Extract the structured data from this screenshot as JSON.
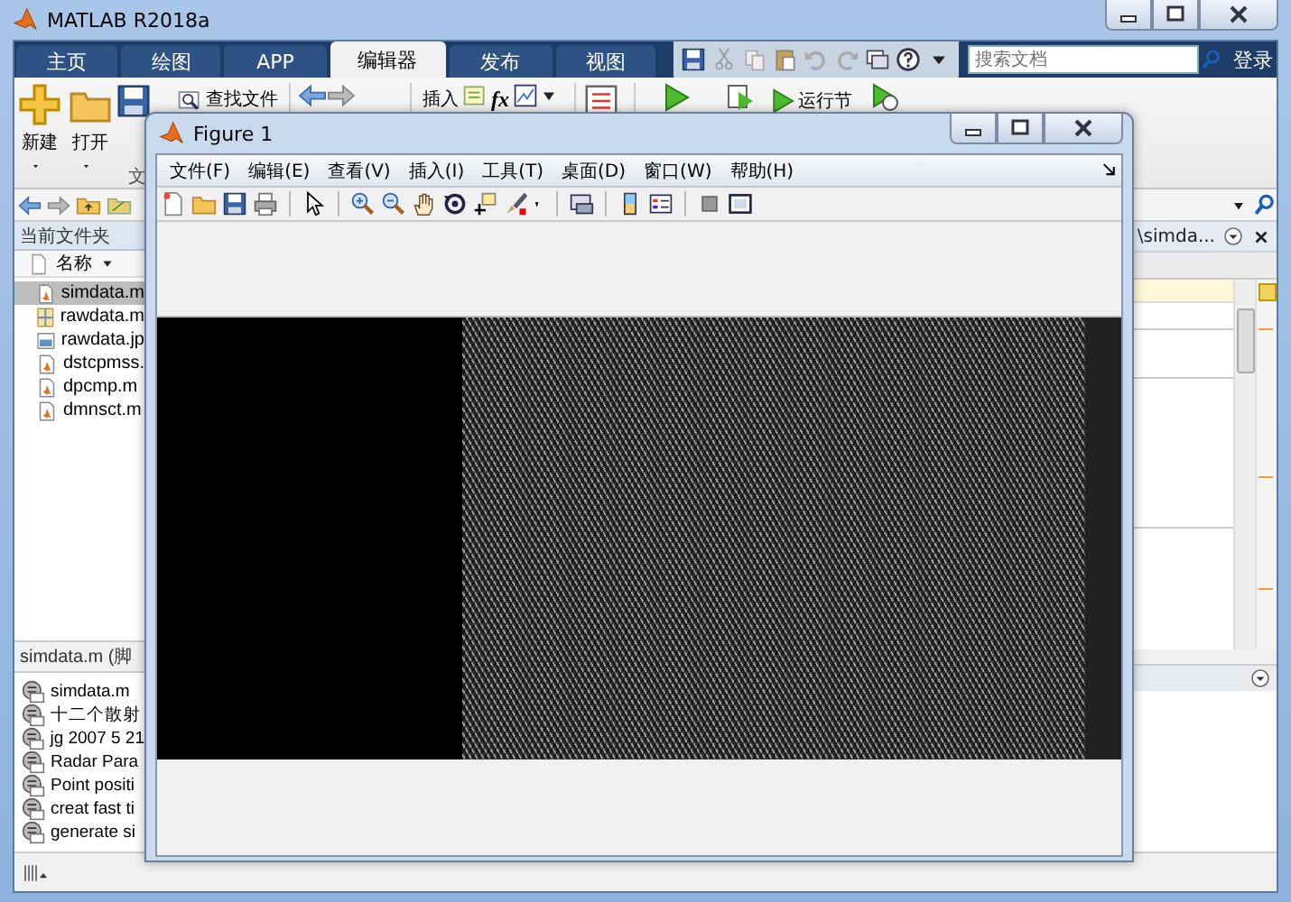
{
  "window": {
    "title": "MATLAB R2018a"
  },
  "tabs": [
    {
      "label": "主页",
      "selected": false
    },
    {
      "label": "绘图",
      "selected": false
    },
    {
      "label": "APP",
      "selected": false
    },
    {
      "label": "编辑器",
      "selected": true
    },
    {
      "label": "发布",
      "selected": false
    },
    {
      "label": "视图",
      "selected": false
    }
  ],
  "search": {
    "placeholder": "搜索文档"
  },
  "login": "登录",
  "toolstrip": {
    "large_buttons": [
      "新建",
      "打开"
    ],
    "find_files": "查找文件",
    "insert": "插入",
    "fx": "fx",
    "run_section": "运行节",
    "section_label": "文"
  },
  "current_folder": {
    "title": "当前文件夹",
    "column": "名称",
    "files": [
      {
        "name": "simdata.m",
        "kind": "script",
        "selected": true
      },
      {
        "name": "rawdata.m",
        "kind": "data",
        "selected": false
      },
      {
        "name": "rawdata.jp",
        "kind": "image",
        "selected": false
      },
      {
        "name": "dstcpmss.",
        "kind": "script",
        "selected": false
      },
      {
        "name": "dpcmp.m",
        "kind": "script",
        "selected": false
      },
      {
        "name": "dmnsct.m",
        "kind": "script",
        "selected": false
      }
    ]
  },
  "details": {
    "title": "simdata.m (脚"
  },
  "sections": [
    "simdata.m",
    "十二个散射",
    "jg 2007 5 21",
    "Radar Para",
    "Point positi",
    "creat fast ti",
    "generate si"
  ],
  "editor": {
    "path": "\\simda..."
  },
  "figure": {
    "title": "Figure 1",
    "menu": [
      "文件(F)",
      "编辑(E)",
      "查看(V)",
      "插入(I)",
      "工具(T)",
      "桌面(D)",
      "窗口(W)",
      "帮助(H)"
    ]
  }
}
